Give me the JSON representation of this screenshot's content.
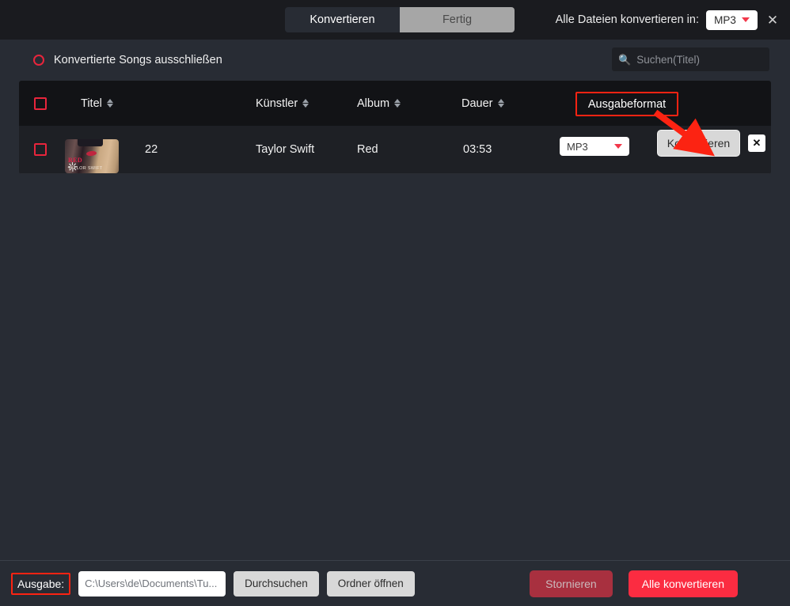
{
  "topbar": {
    "tabs": [
      {
        "label": "Konvertieren",
        "active": true
      },
      {
        "label": "Fertig",
        "active": false
      }
    ],
    "convert_all_label": "Alle Dateien konvertieren in:",
    "global_format": "MP3",
    "close_icon": "close-icon"
  },
  "filter": {
    "exclude_converted_label": "Konvertierte Songs ausschließen",
    "search_placeholder": "Suchen(Titel)",
    "search_value": ""
  },
  "table": {
    "columns": {
      "title": "Titel",
      "artist": "Künstler",
      "album": "Album",
      "duration": "Dauer",
      "output_format": "Ausgabeformat"
    },
    "rows": [
      {
        "title": "22",
        "artist": "Taylor Swift",
        "album": "Red",
        "duration": "03:53",
        "format": "MP3",
        "convert_label": "Konvertieren",
        "delete_label": "✕",
        "artwork_title": "RED",
        "artwork_subtitle": "TAYLOR SWIFT"
      }
    ]
  },
  "bottombar": {
    "output_label": "Ausgabe:",
    "output_path": "C:\\Users\\de\\Documents\\Tu...",
    "browse_label": "Durchsuchen",
    "open_folder_label": "Ordner öffnen",
    "cancel_label": "Stornieren",
    "convert_all_label": "Alle konvertieren"
  },
  "colors": {
    "accent_red": "#fb2c41",
    "highlight_red": "#fc2312",
    "background": "#282c34",
    "topbar": "#1a1b1f",
    "table_header": "#121316",
    "table_row": "#1e2025"
  }
}
